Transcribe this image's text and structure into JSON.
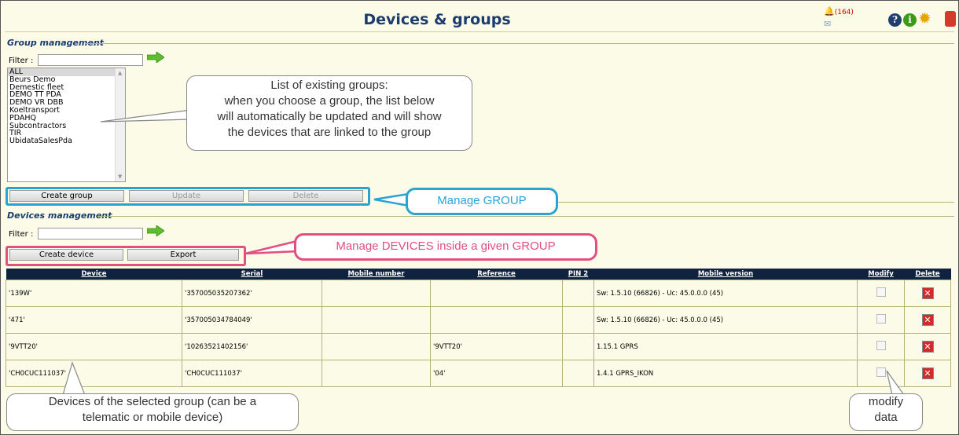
{
  "header": {
    "title": "Devices & groups",
    "alert_count": "(164)"
  },
  "group_section": {
    "label": "Group management",
    "filter_label": "Filter :",
    "groups": [
      "ALL",
      "Beurs Demo",
      "Demestic fleet",
      "DEMO TT PDA",
      "DEMO VR DBB",
      "Koeltransport",
      "PDAHQ",
      "Subcontractors",
      "TIR",
      "UbidataSalesPda"
    ],
    "buttons": {
      "create": "Create group",
      "update": "Update",
      "delete": "Delete"
    }
  },
  "device_section": {
    "label": "Devices management",
    "filter_label": "Filter :",
    "buttons": {
      "create": "Create device",
      "export": "Export"
    }
  },
  "table": {
    "headers": [
      "Device",
      "Serial",
      "Mobile number",
      "Reference",
      "PIN 2",
      "Mobile version",
      "Modify",
      "Delete"
    ],
    "rows": [
      [
        "'139W'",
        "'357005035207362'",
        "",
        "",
        "",
        "Sw: 1.5.10 (66826) - Uc: 45.0.0.0 (45)"
      ],
      [
        "'471'",
        "'357005034784049'",
        "",
        "",
        "",
        "Sw: 1.5.10 (66826) - Uc: 45.0.0.0 (45)"
      ],
      [
        "'9VTT20'",
        "'10263521402156'",
        "",
        "'9VTT20'",
        "",
        "1.15.1 GPRS"
      ],
      [
        "'CH0CUC111037'",
        "'CH0CUC111037'",
        "",
        "'04'",
        "",
        "1.4.1 GPRS_IKON"
      ]
    ]
  },
  "callouts": {
    "groups": "List of existing groups:\nwhen you choose a group, the list below\nwill automatically be updated and will show\nthe devices that are linked to the group",
    "manage_group": "Manage GROUP",
    "manage_devices": "Manage DEVICES inside a given GROUP",
    "devices": "Devices of the selected group (can be a\ntelematic or mobile device)",
    "modify": "modify\ndata"
  },
  "icons": [
    "bell-icon",
    "mail-icon",
    "help-icon",
    "info-icon",
    "gear-icon",
    "power-icon",
    "arrow-go-icon",
    "edit-icon",
    "delete-icon"
  ],
  "colors": {
    "title": "#1d3c6e",
    "table_header": "#0f2240",
    "callout_blue": "#2aa3d4",
    "callout_pink": "#e24f80",
    "background": "#fbfbe8"
  }
}
